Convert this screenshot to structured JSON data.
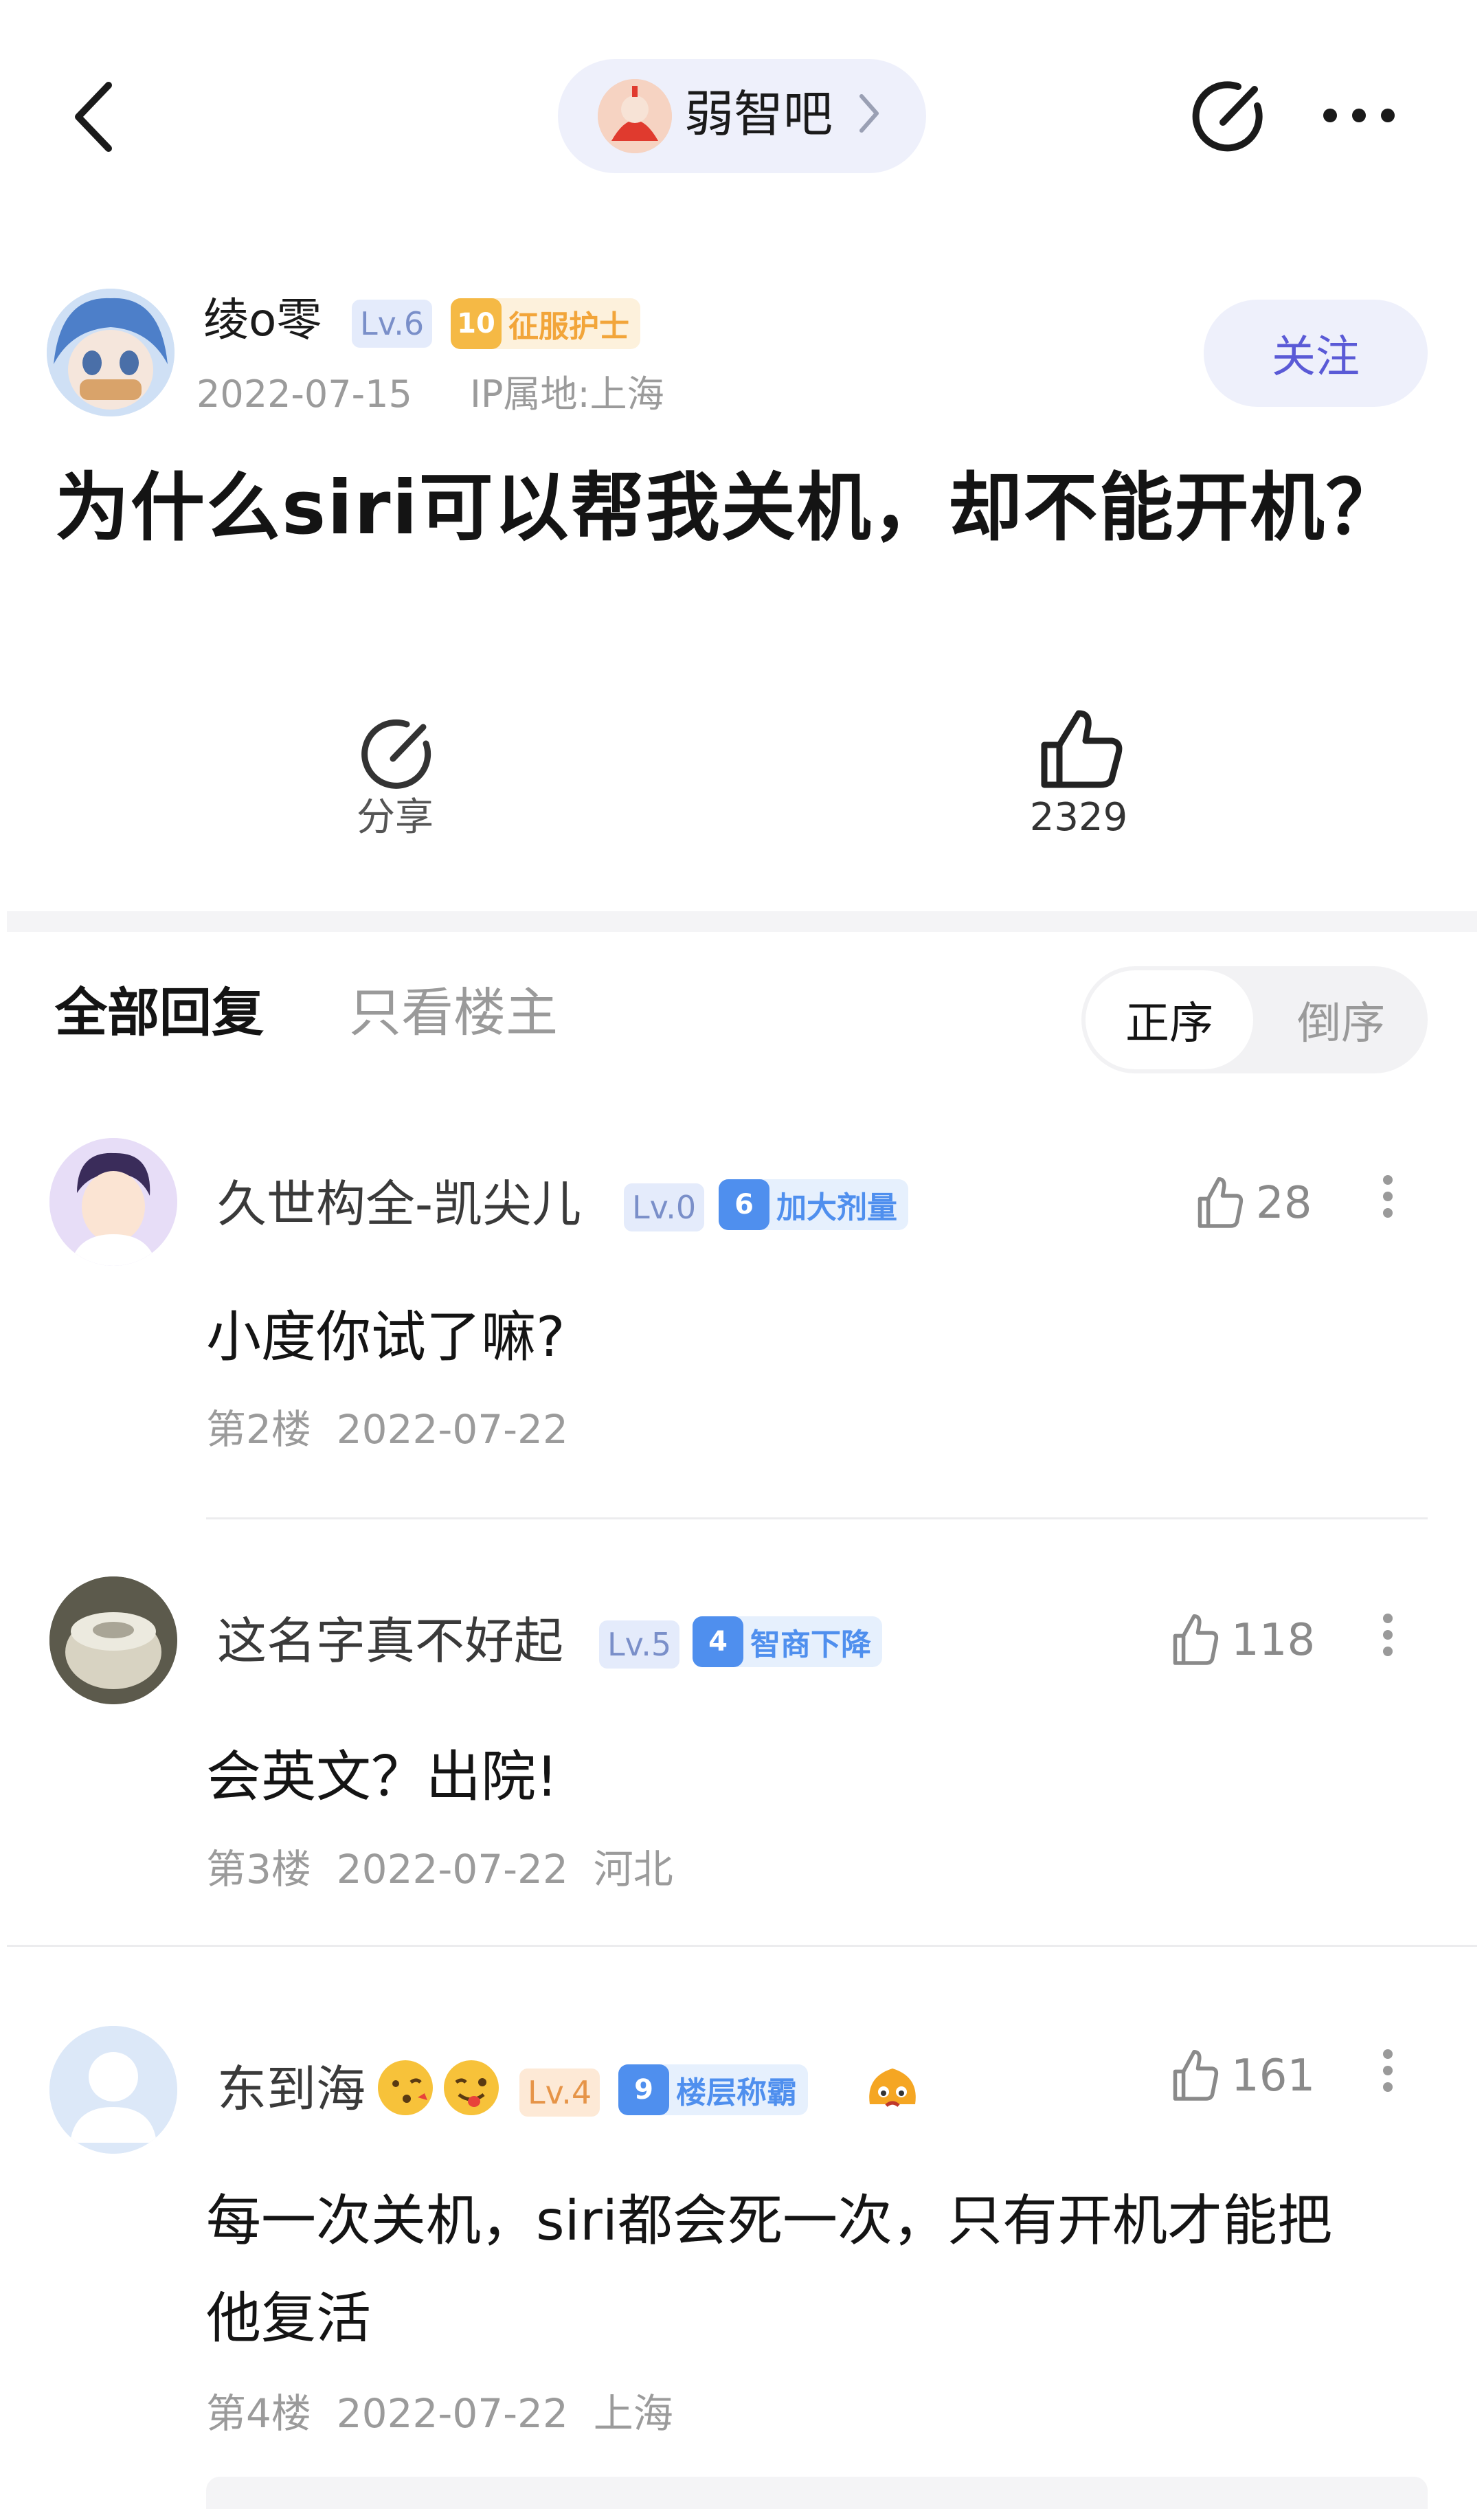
{
  "nav": {
    "back_icon": "chevron-left-icon",
    "forum_name": "弱智吧",
    "share_icon": "share-icon",
    "more_icon": "more-dots-icon"
  },
  "post": {
    "author": {
      "name": "绫o零",
      "level": "Lv.6",
      "title_level": "10",
      "title": "征服护士",
      "date": "2022-07-15",
      "ip": "IP属地:上海",
      "follow_label": "关注"
    },
    "title": "为什么siri可以帮我关机，却不能开机？",
    "actions": {
      "share_label": "分享",
      "like_count": "2329"
    }
  },
  "tabs": {
    "all_replies": "全部回复",
    "op_only": "只看楼主",
    "sort_asc": "正序",
    "sort_desc": "倒序"
  },
  "comments": [
    {
      "name": "久世构全-凯尖儿",
      "level": "Lv.0",
      "title_level": "6",
      "title": "加大剂量",
      "likes": "28",
      "body": "小度你试了嘛?",
      "floor": "第2楼",
      "date": "2022-07-22",
      "location": ""
    },
    {
      "name": "这名字真不好起",
      "level": "Lv.5",
      "title_level": "4",
      "title": "智商下降",
      "likes": "118",
      "body": "会英文？出院!",
      "floor": "第3楼",
      "date": "2022-07-22",
      "location": "河北"
    },
    {
      "name": "东到海",
      "level": "Lv.4",
      "title_level": "9",
      "title": "楼层称霸",
      "likes": "161",
      "body_line1": "每一次关机，siri都会死一次，只有开机才能把",
      "body_line2": "他复活",
      "floor": "第4楼",
      "date": "2022-07-22",
      "location": "上海"
    }
  ],
  "colors": {
    "accent": "#5a5ad6",
    "pill_bg": "#eef0fb",
    "lv_blue_bg": "#e4ebfb",
    "lv_blue_fg": "#7a8fc9",
    "title_orange": "#f2a53a",
    "title_blue": "#4f8fee",
    "lv_orange_bg": "#fde9d6"
  }
}
